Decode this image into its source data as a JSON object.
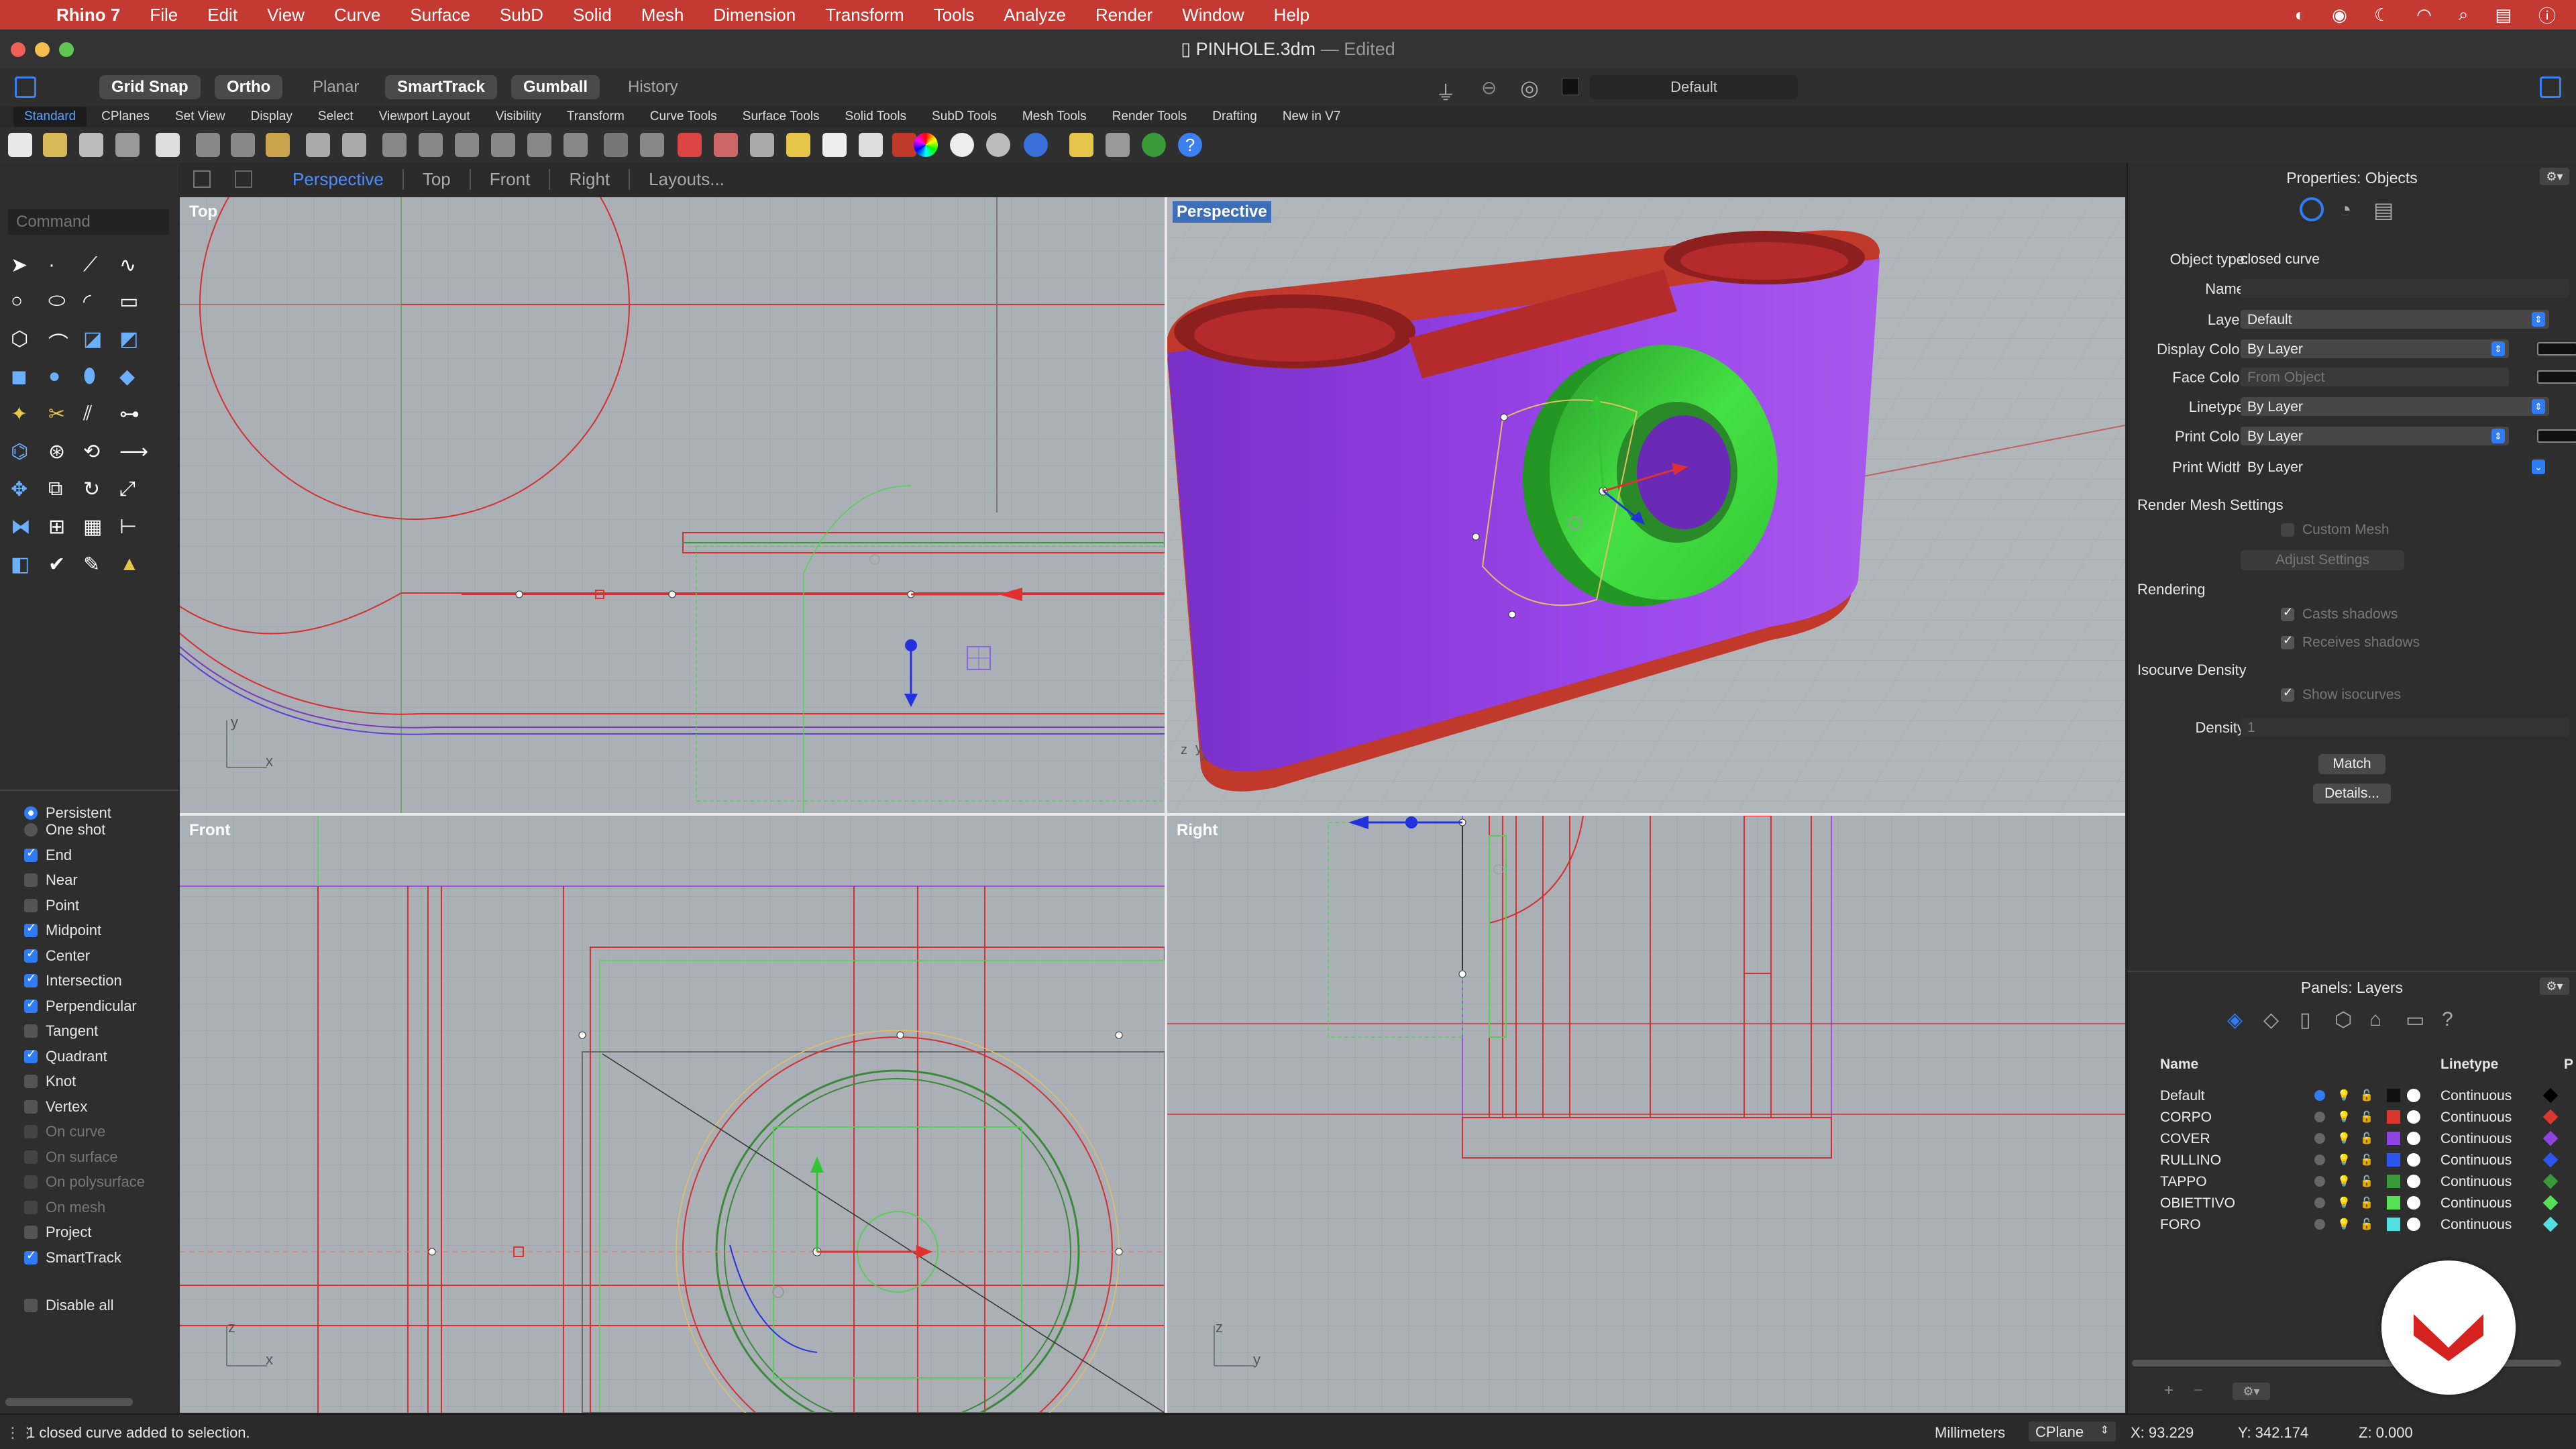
{
  "menubar": {
    "app": "Rhino 7",
    "items": [
      "File",
      "Edit",
      "View",
      "Curve",
      "Surface",
      "SubD",
      "Solid",
      "Mesh",
      "Dimension",
      "Transform",
      "Tools",
      "Analyze",
      "Render",
      "Window",
      "Help"
    ]
  },
  "window": {
    "title": "PINHOLE.3dm",
    "edited": "— Edited"
  },
  "toolbar": {
    "buttons": [
      {
        "label": "Grid Snap",
        "on": true
      },
      {
        "label": "Ortho",
        "on": true
      },
      {
        "label": "Planar",
        "on": false
      },
      {
        "label": "SmartTrack",
        "on": true
      },
      {
        "label": "Gumball",
        "on": true
      },
      {
        "label": "History",
        "on": false
      }
    ],
    "layer": "Default"
  },
  "tabs": [
    "Standard",
    "CPlanes",
    "Set View",
    "Display",
    "Select",
    "Viewport Layout",
    "Visibility",
    "Transform",
    "Curve Tools",
    "Surface Tools",
    "Solid Tools",
    "SubD Tools",
    "Mesh Tools",
    "Render Tools",
    "Drafting",
    "New in V7"
  ],
  "viewport_tabs": [
    "Perspective",
    "Top",
    "Front",
    "Right",
    "Layouts..."
  ],
  "command": {
    "placeholder": "Command"
  },
  "viewports": {
    "top": "Top",
    "perspective": "Perspective",
    "front": "Front",
    "right": "Right"
  },
  "osnap": {
    "modes": [
      {
        "label": "Persistent",
        "type": "radio",
        "on": true
      },
      {
        "label": "One shot",
        "type": "radio",
        "on": false
      }
    ],
    "items": [
      {
        "label": "End",
        "on": true,
        "enabled": true
      },
      {
        "label": "Near",
        "on": false,
        "enabled": true
      },
      {
        "label": "Point",
        "on": false,
        "enabled": true
      },
      {
        "label": "Midpoint",
        "on": true,
        "enabled": true
      },
      {
        "label": "Center",
        "on": true,
        "enabled": true
      },
      {
        "label": "Intersection",
        "on": true,
        "enabled": true
      },
      {
        "label": "Perpendicular",
        "on": true,
        "enabled": true
      },
      {
        "label": "Tangent",
        "on": false,
        "enabled": true
      },
      {
        "label": "Quadrant",
        "on": true,
        "enabled": true
      },
      {
        "label": "Knot",
        "on": false,
        "enabled": true
      },
      {
        "label": "Vertex",
        "on": false,
        "enabled": true
      },
      {
        "label": "On curve",
        "on": false,
        "enabled": false
      },
      {
        "label": "On surface",
        "on": false,
        "enabled": false
      },
      {
        "label": "On polysurface",
        "on": false,
        "enabled": false
      },
      {
        "label": "On mesh",
        "on": false,
        "enabled": false
      },
      {
        "label": "Project",
        "on": false,
        "enabled": true
      },
      {
        "label": "SmartTrack",
        "on": true,
        "enabled": true
      }
    ],
    "disable_all": "Disable all"
  },
  "properties": {
    "title": "Properties: Objects",
    "object_type_label": "Object type:",
    "object_type": "closed curve",
    "name_label": "Name:",
    "layer_label": "Layer:",
    "layer": "Default",
    "display_color_label": "Display Color:",
    "display_color": "By Layer",
    "face_color_label": "Face Color:",
    "face_color": "From Object",
    "linetype_label": "Linetype:",
    "linetype": "By Layer",
    "print_color_label": "Print Color:",
    "print_color": "By Layer",
    "print_width_label": "Print Width:",
    "print_width": "By Layer",
    "render_mesh": "Render Mesh Settings",
    "custom_mesh": "Custom Mesh",
    "adjust_settings": "Adjust Settings",
    "rendering": "Rendering",
    "casts_shadows": "Casts shadows",
    "receives_shadows": "Receives shadows",
    "isocurve_density": "Isocurve Density",
    "show_isocurves": "Show isocurves",
    "density_label": "Density:",
    "density": "1",
    "match": "Match",
    "details": "Details..."
  },
  "layers": {
    "title": "Panels: Layers",
    "col_name": "Name",
    "col_linetype": "Linetype",
    "col_p": "P",
    "rows": [
      {
        "name": "Default",
        "color": "#111111",
        "linetype": "Continuous",
        "current": true,
        "dia": "#000000"
      },
      {
        "name": "CORPO",
        "color": "#d9382e",
        "linetype": "Continuous",
        "current": false,
        "dia": "#d9382e"
      },
      {
        "name": "COVER",
        "color": "#8e44e0",
        "linetype": "Continuous",
        "current": false,
        "dia": "#8e44e0"
      },
      {
        "name": "RULLINO",
        "color": "#2d55f0",
        "linetype": "Continuous",
        "current": false,
        "dia": "#2d55f0"
      },
      {
        "name": "TAPPO",
        "color": "#3a9a3a",
        "linetype": "Continuous",
        "current": false,
        "dia": "#3a9a3a"
      },
      {
        "name": "OBIETTIVO",
        "color": "#55e055",
        "linetype": "Continuous",
        "current": false,
        "dia": "#55e055"
      },
      {
        "name": "FORO",
        "color": "#55e0e0",
        "linetype": "Continuous",
        "current": false,
        "dia": "#55e0e0"
      }
    ]
  },
  "status": {
    "message": "1 closed curve added to selection.",
    "units": "Millimeters",
    "cplane": "CPlane",
    "x": "X: 93.229",
    "y": "Y: 342.174",
    "z": "Z: 0.000"
  },
  "axis_labels": {
    "x": "x",
    "y": "y",
    "z": "z"
  }
}
